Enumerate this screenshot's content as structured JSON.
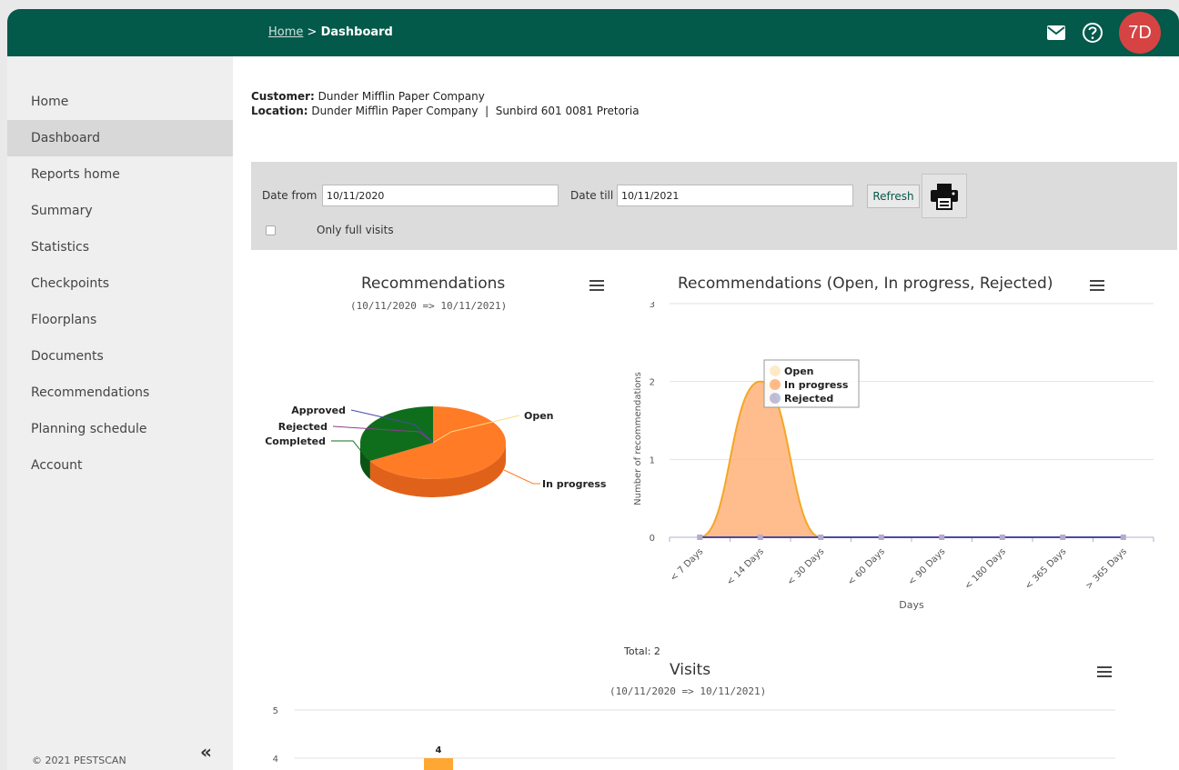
{
  "header": {
    "breadcrumb_home": "Home",
    "breadcrumb_sep": ">",
    "breadcrumb_current": "Dashboard",
    "avatar_initials": "7D",
    "icons": [
      "mail-icon",
      "help-icon"
    ],
    "color": "#03594a"
  },
  "sidebar": {
    "items": [
      {
        "label": "Home"
      },
      {
        "label": "Dashboard",
        "active": true
      },
      {
        "label": "Reports home"
      },
      {
        "label": "Summary"
      },
      {
        "label": "Statistics"
      },
      {
        "label": "Checkpoints"
      },
      {
        "label": "Floorplans"
      },
      {
        "label": "Documents"
      },
      {
        "label": "Recommendations"
      },
      {
        "label": "Planning schedule"
      },
      {
        "label": "Account"
      }
    ],
    "copyright": "© 2021 PESTSCAN",
    "collapse_icon": "«"
  },
  "info": {
    "customer_label": "Customer:",
    "customer_value": "Dunder Mifflin Paper Company",
    "location_label": "Location:",
    "location_value": "Dunder Mifflin Paper Company  |  Sunbird 601 0081 Pretoria"
  },
  "filter": {
    "date_from_label": "Date from",
    "date_from_value": "10/11/2020",
    "date_till_label": "Date till",
    "date_till_value": "10/11/2021",
    "refresh_label": "Refresh",
    "only_full_visits_label": "Only full visits"
  },
  "chart_data": [
    {
      "type": "pie",
      "title": "Recommendations",
      "subtitle": "(10/11/2020 => 10/11/2021)",
      "labels": [
        "Open",
        "In progress",
        "Rejected",
        "Approved",
        "Completed"
      ],
      "values": [
        0,
        2,
        0,
        0,
        1
      ],
      "colors": [
        "#ffe8c2",
        "#ff7b26",
        "#8e3c8e",
        "#4a4aa0",
        "#0f6e1c"
      ]
    },
    {
      "type": "area",
      "title": "Recommendations (Open, In progress, Rejected)",
      "ylabel": "Number of recommendations",
      "xlabel": "Days",
      "categories": [
        "< 7 Days",
        "< 14 Days",
        "< 30 Days",
        "< 60 Days",
        "< 90 Days",
        "< 180 Days",
        "< 365 Days",
        "> 365 Days"
      ],
      "y_ticks": [
        "0",
        "1",
        "2",
        "3"
      ],
      "ylim": [
        0,
        3
      ],
      "series": [
        {
          "name": "Open",
          "values": [
            0,
            0,
            0,
            0,
            0,
            0,
            0,
            0
          ],
          "color": "#ffe8c2"
        },
        {
          "name": "In progress",
          "values": [
            0,
            2,
            0,
            0,
            0,
            0,
            0,
            0
          ],
          "color": "#ffb27a"
        },
        {
          "name": "Rejected",
          "values": [
            0,
            0,
            0,
            0,
            0,
            0,
            0,
            0
          ],
          "color": "#4a4aa0"
        }
      ],
      "total": "Total: 2"
    },
    {
      "type": "bar",
      "title": "Visits",
      "subtitle": "(10/11/2020 => 10/11/2021)",
      "y_ticks": [
        "4",
        "5"
      ],
      "values": [
        4
      ],
      "data_label": "4",
      "color": "#ffa733"
    }
  ]
}
